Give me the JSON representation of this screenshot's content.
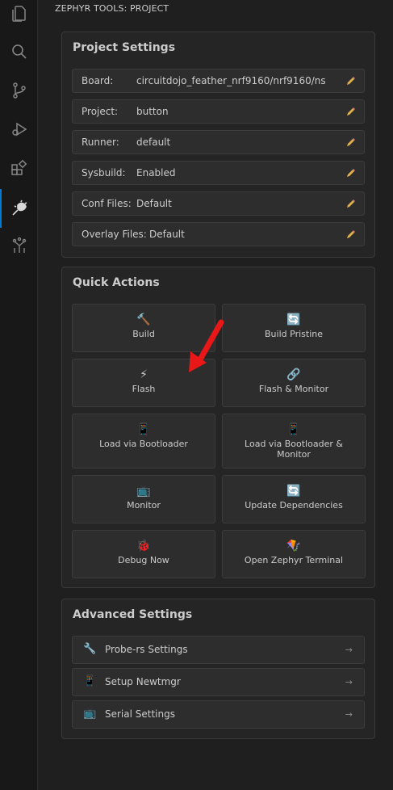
{
  "sidebar_title": "ZEPHYR TOOLS: PROJECT",
  "project_settings": {
    "title": "Project Settings",
    "rows": [
      {
        "label": "Board:",
        "value": "circuitdojo_feather_nrf9160/nrf9160/ns"
      },
      {
        "label": "Project:",
        "value": "button"
      },
      {
        "label": "Runner:",
        "value": "default"
      },
      {
        "label": "Sysbuild:",
        "value": "Enabled"
      },
      {
        "label": "Conf Files:",
        "value": "Default"
      },
      {
        "label": "Overlay Files:",
        "value": "Default"
      }
    ]
  },
  "quick_actions": {
    "title": "Quick Actions",
    "buttons": [
      {
        "icon": "🔨",
        "label": "Build"
      },
      {
        "icon": "🔄",
        "label": "Build Pristine"
      },
      {
        "icon": "⚡",
        "label": "Flash"
      },
      {
        "icon": "🔗",
        "label": "Flash & Monitor"
      },
      {
        "icon": "📱",
        "label": "Load via Bootloader"
      },
      {
        "icon": "📱",
        "label": "Load via Bootloader & Monitor"
      },
      {
        "icon": "📺",
        "label": "Monitor"
      },
      {
        "icon": "🔄",
        "label": "Update Dependencies"
      },
      {
        "icon": "🐞",
        "label": "Debug Now"
      },
      {
        "icon": "🪁",
        "label": "Open Zephyr Terminal"
      }
    ]
  },
  "advanced_settings": {
    "title": "Advanced Settings",
    "rows": [
      {
        "icon": "🔧",
        "label": "Probe-rs Settings",
        "arrow": "→"
      },
      {
        "icon": "📱",
        "label": "Setup Newtmgr",
        "arrow": "→"
      },
      {
        "icon": "📺",
        "label": "Serial Settings",
        "arrow": "→"
      }
    ]
  },
  "colors": {
    "accent": "#0078d4",
    "annotation_arrow": "#e81818"
  }
}
